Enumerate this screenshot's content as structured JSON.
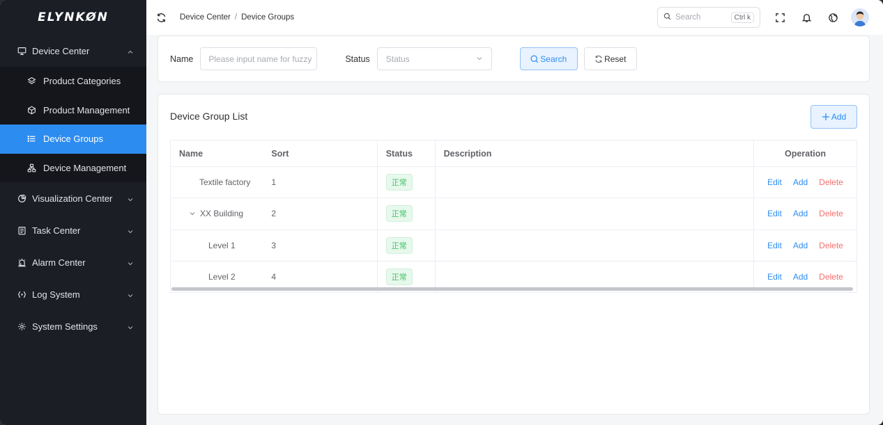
{
  "brand": {
    "logo_text": "ELYNKØN"
  },
  "sidebar": {
    "groups": [
      {
        "label": "Device Center",
        "icon": "monitor-icon",
        "expanded": true,
        "items": [
          {
            "label": "Product Categories",
            "icon": "layers-icon",
            "active": false
          },
          {
            "label": "Product Management",
            "icon": "cube-icon",
            "active": false
          },
          {
            "label": "Device Groups",
            "icon": "list-icon",
            "active": true
          },
          {
            "label": "Device Management",
            "icon": "hierarchy-icon",
            "active": false
          }
        ]
      },
      {
        "label": "Visualization Center",
        "icon": "pie-chart-icon",
        "expanded": false
      },
      {
        "label": "Task Center",
        "icon": "clipboard-icon",
        "expanded": false
      },
      {
        "label": "Alarm Center",
        "icon": "alarm-icon",
        "expanded": false
      },
      {
        "label": "Log System",
        "icon": "code-braces-icon",
        "expanded": false
      },
      {
        "label": "System Settings",
        "icon": "gear-icon",
        "expanded": false
      }
    ]
  },
  "header": {
    "breadcrumb": [
      "Device Center",
      "Device Groups"
    ],
    "breadcrumb_sep": "/",
    "search_placeholder": "Search",
    "search_shortcut": "Ctrl k"
  },
  "filter": {
    "name_label": "Name",
    "name_placeholder": "Please input name for fuzzy",
    "status_label": "Status",
    "status_placeholder": "Status",
    "search_button": "Search",
    "reset_button": "Reset"
  },
  "list": {
    "title": "Device Group List",
    "add_button": "Add",
    "columns": [
      "Name",
      "Sort",
      "Status",
      "Description",
      "Operation"
    ],
    "rows": [
      {
        "name": "Textile factory",
        "sort": "1",
        "status": "正常",
        "description": ""
      },
      {
        "name": "XX Building",
        "sort": "2",
        "status": "正常",
        "description": ""
      },
      {
        "name": "Level 1",
        "sort": "3",
        "status": "正常",
        "description": ""
      },
      {
        "name": "Level 2",
        "sort": "4",
        "status": "正常",
        "description": ""
      }
    ],
    "ops": {
      "edit": "Edit",
      "add": "Add",
      "delete": "Delete"
    }
  },
  "colors": {
    "accent": "#2d8cf0",
    "danger": "#f56c6c",
    "success": "#44c267",
    "sidebar_bg": "#1c1e26"
  }
}
